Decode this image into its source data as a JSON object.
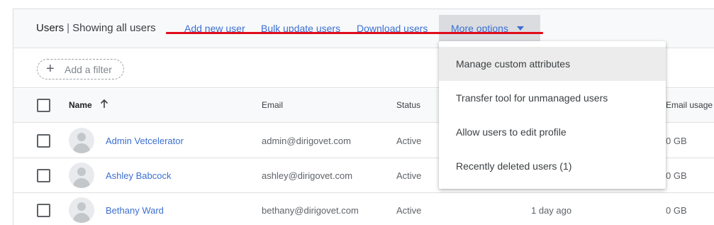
{
  "toolbar": {
    "title": "Users",
    "separator": "|",
    "subtitle": "Showing all users",
    "add_new_user": "Add new user",
    "bulk_update_users": "Bulk update users",
    "download_users": "Download users",
    "more_options": "More options"
  },
  "filter": {
    "add_filter_label": "Add a filter"
  },
  "table": {
    "headers": {
      "name": "Name",
      "email": "Email",
      "status": "Status",
      "email_usage": "Email usage"
    },
    "rows": [
      {
        "name": "Admin Vetcelerator",
        "email": "admin@dirigovet.com",
        "status": "Active",
        "last_sign_in": "",
        "email_usage": "0 GB"
      },
      {
        "name": "Ashley Babcock",
        "email": "ashley@dirigovet.com",
        "status": "Active",
        "last_sign_in": "",
        "email_usage": "0 GB"
      },
      {
        "name": "Bethany Ward",
        "email": "bethany@dirigovet.com",
        "status": "Active",
        "last_sign_in": "1 day ago",
        "email_usage": "0 GB"
      }
    ]
  },
  "more_options_menu": {
    "items": [
      {
        "label": "Manage custom attributes",
        "highlighted": true
      },
      {
        "label": "Transfer tool for unmanaged users",
        "highlighted": false
      },
      {
        "label": "Allow users to edit profile",
        "highlighted": false
      },
      {
        "label": "Recently deleted users (1)",
        "highlighted": false
      }
    ]
  },
  "icons": {
    "sort": "arrow-up-icon",
    "filter": "plus-icon",
    "dropdown": "caret-down-icon",
    "avatar": "default-avatar-icon"
  },
  "colors": {
    "link": "#3c6fd1",
    "annotation_underline": "#e00d1c",
    "toolbar_bg": "#f8f9fa",
    "menu_hover": "#ececec"
  }
}
